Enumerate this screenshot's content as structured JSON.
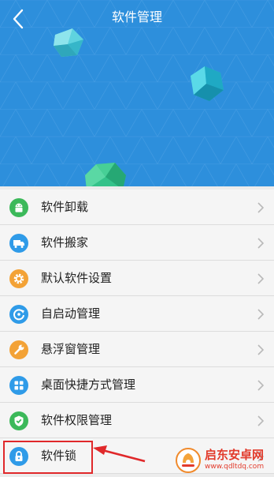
{
  "header": {
    "title": "软件管理",
    "background_color": "#2d8fdc"
  },
  "menu": {
    "items": [
      {
        "label": "软件卸载",
        "icon": "android-icon",
        "color": "#3cb95a"
      },
      {
        "label": "软件搬家",
        "icon": "truck-icon",
        "color": "#2f9be8"
      },
      {
        "label": "默认软件设置",
        "icon": "gear-icon",
        "color": "#f3a236"
      },
      {
        "label": "自启动管理",
        "icon": "power-refresh-icon",
        "color": "#2f9be8"
      },
      {
        "label": "悬浮窗管理",
        "icon": "wrench-icon",
        "color": "#f3a236"
      },
      {
        "label": "桌面快捷方式管理",
        "icon": "grid-icon",
        "color": "#2f9be8"
      },
      {
        "label": "软件权限管理",
        "icon": "shield-check-icon",
        "color": "#3cb95a"
      },
      {
        "label": "软件锁",
        "icon": "lock-icon",
        "color": "#2f9be8"
      }
    ]
  },
  "watermark": {
    "name": "启东安卓网",
    "url": "www.qdltdq.com",
    "color": "#e23b2c"
  }
}
